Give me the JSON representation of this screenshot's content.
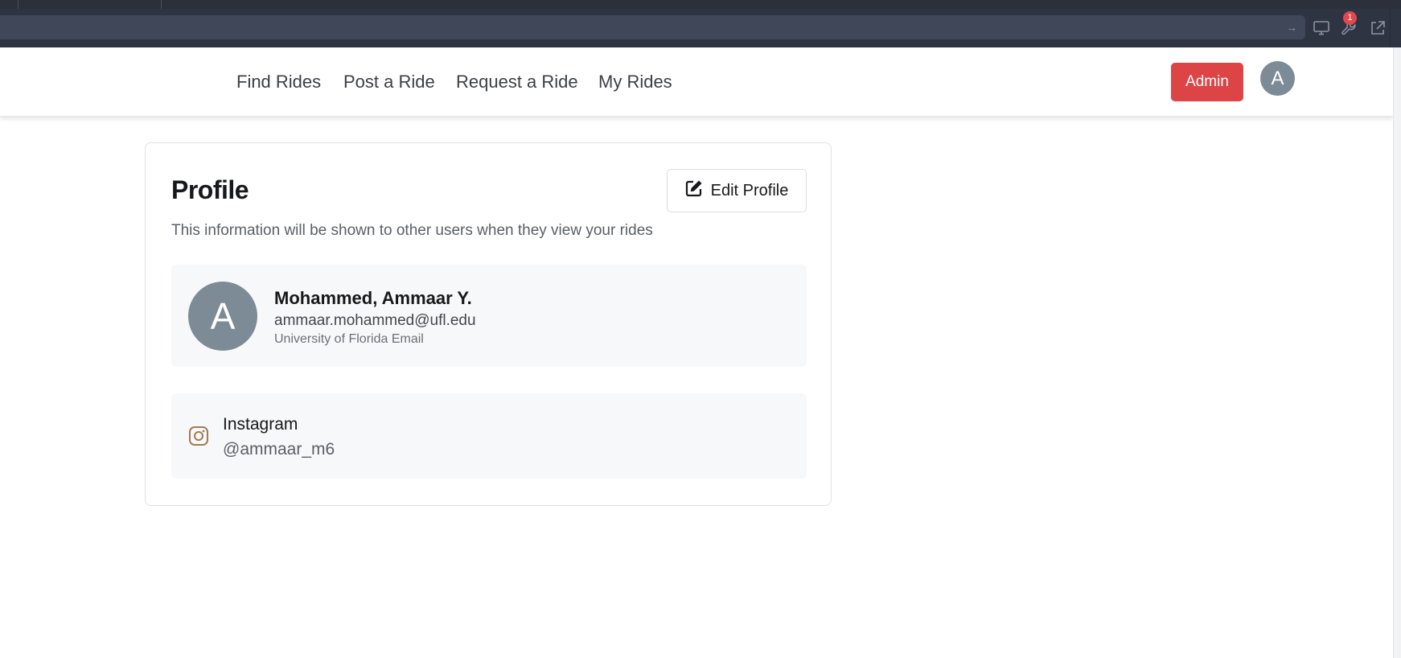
{
  "browser": {
    "notification_count": "1",
    "icons": [
      "arrow-right-icon",
      "monitor-icon",
      "wrench-icon",
      "external-link-icon"
    ]
  },
  "nav": {
    "links": [
      "Find Rides",
      "Post a Ride",
      "Request a Ride",
      "My Rides"
    ],
    "admin_label": "Admin",
    "avatar_initial": "A"
  },
  "profile": {
    "title": "Profile",
    "edit_label": "Edit Profile",
    "subtitle": "This information will be shown to other users when they view your rides",
    "user": {
      "initial": "A",
      "name": "Mohammed, Ammaar Y.",
      "email": "ammaar.mohammed@ufl.edu",
      "email_label": "University of Florida Email"
    },
    "social": {
      "platform": "Instagram",
      "handle": "@ammaar_m6",
      "icon": "instagram-icon",
      "icon_color": "#a37b52"
    }
  },
  "colors": {
    "admin": "#dc4446",
    "avatar": "#7d8b97"
  }
}
